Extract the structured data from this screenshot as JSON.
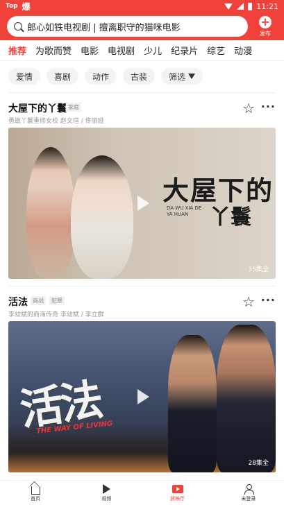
{
  "statusbar": {
    "logo": "Top",
    "logo2": "爆",
    "time": "11:21"
  },
  "search": {
    "text": "郎心如铁电视剧 | 擅离职守的猫咪电影",
    "icon": "search-icon"
  },
  "publish": {
    "label": "发布",
    "icon": "plus-circle-icon"
  },
  "tabs": [
    {
      "label": "推荐",
      "active": true
    },
    {
      "label": "为歌而赞",
      "active": false
    },
    {
      "label": "电影",
      "active": false
    },
    {
      "label": "电视剧",
      "active": false
    },
    {
      "label": "少儿",
      "active": false
    },
    {
      "label": "纪录片",
      "active": false
    },
    {
      "label": "综艺",
      "active": false
    },
    {
      "label": "动漫",
      "active": false
    }
  ],
  "filters": [
    "爱情",
    "喜剧",
    "动作",
    "古装"
  ],
  "filter_button": {
    "label": "筛选",
    "icon": "filter-icon"
  },
  "cards": [
    {
      "title": "大屋下的丫鬟",
      "tags": [
        "家庭"
      ],
      "subtitle": "勇敢丫鬟重修女校    赵文瑄 / 佟丽娅",
      "poster_title": "大屋下的",
      "poster_title2": "丫鬟",
      "poster_pinyin": "DA WU XIA DE\nYA HUAN",
      "episodes": "35集全"
    },
    {
      "title": "活法",
      "tags": [
        "商战",
        "犯罪"
      ],
      "subtitle": "李幼斌的商海传奇    李幼斌 / 李立群",
      "poster_title": "活法",
      "poster_sub": "THE WAY OF LIVING",
      "episodes": "28集全"
    }
  ],
  "bottomnav": [
    {
      "label": "首页",
      "icon": "home-icon",
      "active": false
    },
    {
      "label": "视频",
      "icon": "video-icon",
      "active": false
    },
    {
      "label": "放映厅",
      "icon": "cinema-icon",
      "active": true
    },
    {
      "label": "未登录",
      "icon": "user-icon",
      "active": false
    }
  ],
  "colors": {
    "accent": "#f0413b"
  }
}
